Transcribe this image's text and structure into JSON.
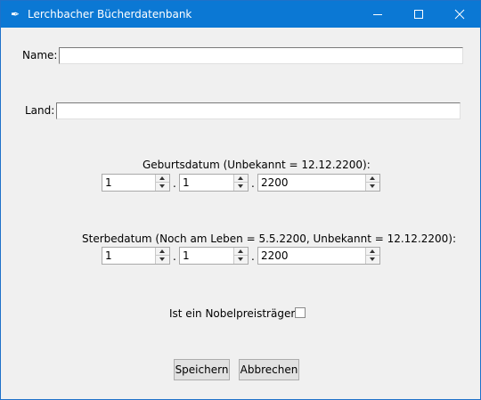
{
  "window": {
    "title": "Lerchbacher Bücherdatenbank",
    "icon": "feather-icon"
  },
  "form": {
    "name_label": "Name:",
    "name_value": "",
    "land_label": "Land:",
    "land_value": "",
    "birth": {
      "label": "Geburtsdatum (Unbekannt = 12.12.2200):",
      "day": "1",
      "month": "1",
      "year": "2200",
      "separator": "."
    },
    "death": {
      "label": "Sterbedatum (Noch am Leben = 5.5.2200, Unbekannt = 12.12.2200):",
      "day": "1",
      "month": "1",
      "year": "2200",
      "separator": "."
    },
    "nobel_label": "Ist ein Nobelpreisträger?:",
    "nobel_checked": false
  },
  "buttons": {
    "save": "Speichern",
    "cancel": "Abbrechen"
  }
}
